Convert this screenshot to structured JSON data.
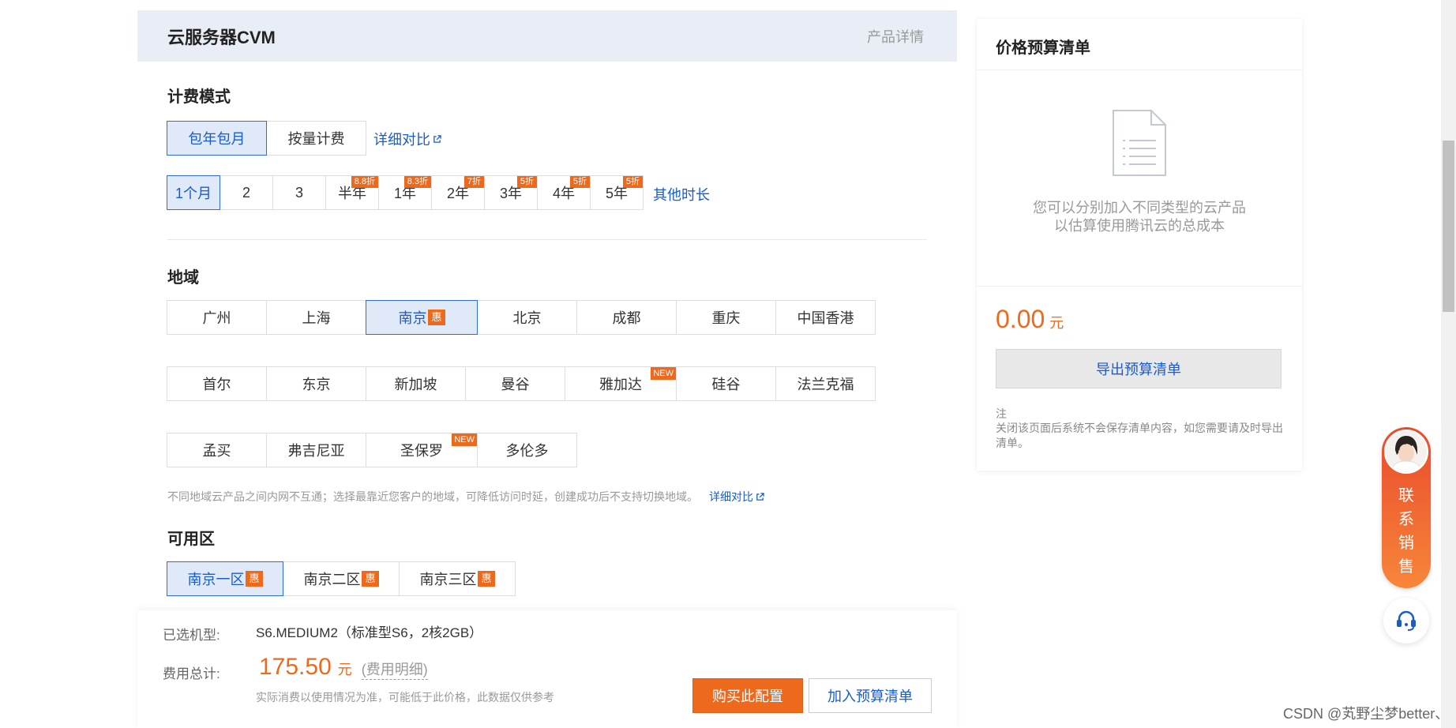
{
  "header": {
    "title": "云服务器CVM",
    "detail_link": "产品详情"
  },
  "billing": {
    "title": "计费模式",
    "options": [
      "包年包月",
      "按量计费"
    ],
    "compare_link": "详细对比",
    "durations": [
      {
        "label": "1个月",
        "discount": ""
      },
      {
        "label": "2",
        "discount": ""
      },
      {
        "label": "3",
        "discount": ""
      },
      {
        "label": "半年",
        "discount": "8.8折"
      },
      {
        "label": "1年",
        "discount": "8.3折"
      },
      {
        "label": "2年",
        "discount": "7折"
      },
      {
        "label": "3年",
        "discount": "5折"
      },
      {
        "label": "4年",
        "discount": "5折"
      },
      {
        "label": "5年",
        "discount": "5折"
      }
    ],
    "other_duration_link": "其他时长"
  },
  "region": {
    "title": "地域",
    "rows": [
      [
        "广州",
        "上海",
        "南京",
        "北京",
        "成都",
        "重庆",
        "中国香港"
      ],
      [
        "首尔",
        "东京",
        "新加坡",
        "曼谷",
        "雅加达",
        "硅谷",
        "法兰克福"
      ],
      [
        "孟买",
        "弗吉尼亚",
        "圣保罗",
        "多伦多"
      ]
    ],
    "hui_badge": "惠",
    "new_badge": "NEW",
    "note": "不同地域云产品之间内网不互通；选择最靠近您客户的地域，可降低访问时延，创建成功后不支持切换地域。",
    "compare_link": "详细对比"
  },
  "zone": {
    "title": "可用区",
    "options": [
      "南京一区",
      "南京二区",
      "南京三区"
    ],
    "hui_badge": "惠"
  },
  "summary": {
    "model_label": "已选机型:",
    "model_value": "S6.MEDIUM2（标准型S6，2核2GB）",
    "total_label": "费用总计:",
    "price": "175.50",
    "unit": "元",
    "fee_detail": "(费用明细)",
    "disclaimer": "实际消费以使用情况为准，可能低于此价格，此数据仅供参考",
    "buy_button": "购买此配置",
    "add_budget_button": "加入预算清单"
  },
  "budget": {
    "title": "价格预算清单",
    "empty_line1": "您可以分别加入不同类型的云产品",
    "empty_line2": "以估算使用腾讯云的总成本",
    "total": "0.00",
    "unit": "元",
    "export_button": "导出预算清单",
    "note_heading": "注",
    "note_body": "关闭该页面后系统不会保存清单内容，如您需要请及时导出清单。"
  },
  "contact": {
    "label": "联系销售"
  },
  "watermark": "CSDN @芄野尘梦better、",
  "colors": {
    "accent": "#ed6a1d",
    "link": "#1a5cc8",
    "selected_bg": "#dfe9f8",
    "header_bg": "#e9eef6"
  }
}
